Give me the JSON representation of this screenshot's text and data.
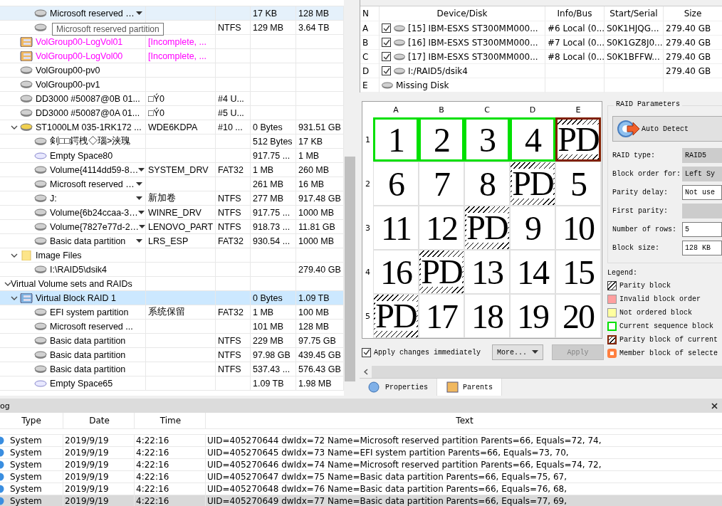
{
  "tree": {
    "tooltip": "Microsoft reserved partition",
    "items": [
      {
        "kind": "continued",
        "children": [
          {
            "kind": "continued",
            "children": [
              {
                "name": "Microsoft reserved …",
                "kind": "disk",
                "menu": true,
                "hovered": true,
                "cells": [
                  "",
                  "",
                  "17 KB",
                  "128 MB"
                ]
              },
              {
                "kind": "disk",
                "cells": [
                  "",
                  "NTFS",
                  "129 MB",
                  "3.64 TB"
                ]
              }
            ]
          },
          {
            "name": "VolGroup00-LogVol01",
            "kind": "volume-group",
            "incomplete": true,
            "cells": [
              "[Incomplete, ...",
              "",
              "",
              ""
            ]
          },
          {
            "name": "VolGroup00-LogVol00",
            "kind": "volume-group",
            "incomplete": true,
            "cells": [
              "[Incomplete, ...",
              "",
              "",
              ""
            ]
          },
          {
            "name": "VolGroup00-pv0",
            "kind": "disk",
            "cells": [
              "",
              "",
              "",
              ""
            ]
          },
          {
            "name": "VolGroup00-pv1",
            "kind": "disk",
            "cells": [
              "",
              "",
              "",
              ""
            ]
          },
          {
            "name": "DD3000 #50087@0B 01...",
            "kind": "disk",
            "cells": [
              "□Ý0",
              "#4 U...",
              "",
              ""
            ]
          },
          {
            "name": "DD3000 #50087@0A 01...",
            "kind": "disk",
            "cells": [
              "□Ý0",
              "#5 U...",
              "",
              ""
            ]
          },
          {
            "name": "ST1000LM 035-1RK172 ...",
            "kind": "yellow-disk",
            "expanded": true,
            "cells": [
              "WDE6KDPA",
              "#10 ...",
              "0 Bytes",
              "931.51 GB"
            ],
            "children": [
              {
                "name": "剣□□鍔栧◇瑙>浃瑰",
                "kind": "disk",
                "cells": [
                  "",
                  "",
                  "512 Bytes",
                  "17 KB"
                ]
              },
              {
                "name": "Empty Space80",
                "kind": "empty",
                "cells": [
                  "",
                  "",
                  "917.75 ...",
                  "1 MB"
                ]
              },
              {
                "name": "Volume{4114dd59-8…",
                "kind": "disk",
                "menu": true,
                "cells": [
                  "SYSTEM_DRV",
                  "FAT32",
                  "1 MB",
                  "260 MB"
                ]
              },
              {
                "name": "Microsoft reserved …",
                "kind": "disk",
                "menu": true,
                "cells": [
                  "",
                  "",
                  "261 MB",
                  "16 MB"
                ]
              },
              {
                "name": "J:",
                "kind": "disk",
                "menu": true,
                "cells": [
                  "新加卷",
                  "NTFS",
                  "277 MB",
                  "917.48 GB"
                ]
              },
              {
                "name": "Volume{6b24ccaa-3…",
                "kind": "disk",
                "menu": true,
                "cells": [
                  "WINRE_DRV",
                  "NTFS",
                  "917.75 ...",
                  "1000 MB"
                ]
              },
              {
                "name": "Volume{7827e77d-2…",
                "kind": "disk",
                "menu": true,
                "cells": [
                  "LENOVO_PART",
                  "NTFS",
                  "918.73 ...",
                  "11.81 GB"
                ]
              },
              {
                "name": "Basic data partition",
                "kind": "disk",
                "menu": true,
                "cells": [
                  "LRS_ESP",
                  "FAT32",
                  "930.54 ...",
                  "1000 MB"
                ]
              }
            ]
          },
          {
            "name": "Image Files",
            "kind": "folder",
            "expanded": true,
            "cells": [
              "",
              "",
              "",
              ""
            ],
            "children": [
              {
                "name": "I:\\RAID5\\dsik4",
                "kind": "disk",
                "cells": [
                  "",
                  "",
                  "",
                  "279.40 GB"
                ]
              }
            ]
          }
        ]
      },
      {
        "name": "Virtual Volume sets and RAIDs",
        "kind": "group",
        "expanded": true,
        "cells": [
          "",
          "",
          "",
          ""
        ],
        "children": [
          {
            "name": "Virtual Block RAID 1",
            "kind": "raid",
            "expanded": true,
            "selected": true,
            "cells": [
              "",
              "",
              "0 Bytes",
              "1.09 TB"
            ],
            "children": [
              {
                "name": "EFI system partition",
                "kind": "disk",
                "cells": [
                  "系统保留",
                  "FAT32",
                  "1 MB",
                  "100 MB"
                ]
              },
              {
                "name": "Microsoft reserved ...",
                "kind": "disk",
                "cells": [
                  "",
                  "",
                  "101 MB",
                  "128 MB"
                ]
              },
              {
                "name": "Basic data partition",
                "kind": "disk",
                "cells": [
                  "",
                  "NTFS",
                  "229 MB",
                  "97.75 GB"
                ]
              },
              {
                "name": "Basic data partition",
                "kind": "disk",
                "cells": [
                  "",
                  "NTFS",
                  "97.98 GB",
                  "439.45 GB"
                ]
              },
              {
                "name": "Basic data partition",
                "kind": "disk",
                "cells": [
                  "",
                  "NTFS",
                  "537.43 ...",
                  "576.43 GB"
                ]
              },
              {
                "name": "Empty Space65",
                "kind": "empty",
                "cells": [
                  "",
                  "",
                  "1.09 TB",
                  "1.98 MB"
                ]
              }
            ]
          }
        ]
      }
    ]
  },
  "disks": {
    "columns": [
      "N",
      "Device/Disk",
      "Info/Bus",
      "Start/Serial",
      "Size"
    ],
    "rows": [
      {
        "n": "A",
        "kind": "member",
        "checked": true,
        "device": "[15] IBM-ESXS ST300MM000...",
        "bus": "#6 Local (0...",
        "serial": "S0K1HJQG...",
        "size": "279.40 GB"
      },
      {
        "n": "B",
        "kind": "member",
        "checked": true,
        "device": "[16] IBM-ESXS ST300MM000...",
        "bus": "#7 Local (0...",
        "serial": "S0K1GZ8J0...",
        "size": "279.40 GB"
      },
      {
        "n": "C",
        "kind": "member",
        "checked": true,
        "device": "[17] IBM-ESXS ST300MM000...",
        "bus": "#8 Local (0...",
        "serial": "S0K1BFFW...",
        "size": "279.40 GB"
      },
      {
        "n": "D",
        "kind": "member",
        "checked": true,
        "device": "I:/RAID5/dsik4",
        "size": "279.40 GB"
      },
      {
        "n": "E",
        "kind": "missing",
        "device": "Missing Disk"
      }
    ]
  },
  "grid": {
    "columns": [
      "A",
      "B",
      "C",
      "D",
      "E"
    ],
    "rows": [
      {
        "label": "1",
        "cells": [
          {
            "text": "1",
            "kind": "data",
            "current": true
          },
          {
            "text": "2",
            "kind": "data",
            "current": true
          },
          {
            "text": "3",
            "kind": "data",
            "current": true
          },
          {
            "text": "4",
            "kind": "data",
            "current": true
          },
          {
            "text": "PD",
            "kind": "parity",
            "current": true
          }
        ]
      },
      {
        "label": "2",
        "cells": [
          {
            "text": "6",
            "kind": "data",
            "current": false
          },
          {
            "text": "7",
            "kind": "data",
            "current": false
          },
          {
            "text": "8",
            "kind": "data",
            "current": false
          },
          {
            "text": "PD",
            "kind": "parity",
            "current": false
          },
          {
            "text": "5",
            "kind": "data",
            "current": false
          }
        ]
      },
      {
        "label": "3",
        "cells": [
          {
            "text": "11",
            "kind": "data",
            "current": false
          },
          {
            "text": "12",
            "kind": "data",
            "current": false
          },
          {
            "text": "PD",
            "kind": "parity",
            "current": false
          },
          {
            "text": "9",
            "kind": "data",
            "current": false
          },
          {
            "text": "10",
            "kind": "data",
            "current": false
          }
        ]
      },
      {
        "label": "4",
        "cells": [
          {
            "text": "16",
            "kind": "data",
            "current": false
          },
          {
            "text": "PD",
            "kind": "parity",
            "current": false
          },
          {
            "text": "13",
            "kind": "data",
            "current": false
          },
          {
            "text": "14",
            "kind": "data",
            "current": false
          },
          {
            "text": "15",
            "kind": "data",
            "current": false
          }
        ]
      },
      {
        "label": "5",
        "cells": [
          {
            "text": "PD",
            "kind": "parity",
            "current": false
          },
          {
            "text": "17",
            "kind": "data",
            "current": false
          },
          {
            "text": "18",
            "kind": "data",
            "current": false
          },
          {
            "text": "19",
            "kind": "data",
            "current": false
          },
          {
            "text": "20",
            "kind": "data",
            "current": false
          }
        ]
      }
    ],
    "apply_immediately": {
      "label": "Apply changes immediately",
      "checked": true
    },
    "more": "More...",
    "apply": {
      "label": "Apply",
      "disabled": true
    }
  },
  "params": {
    "title": "RAID Parameters",
    "auto_detect": "Auto Detect",
    "fields": [
      {
        "label": "RAID type:",
        "value": "RAID5",
        "disabled": true
      },
      {
        "label": "Block order for:",
        "value": "Left Sy",
        "disabled": true
      },
      {
        "label": "Parity delay:",
        "value": "Not use",
        "disabled": false
      },
      {
        "label": "First parity:",
        "disabled": true
      },
      {
        "label": "Number of rows:",
        "value": "5",
        "disabled": false
      },
      {
        "label": "Block size:",
        "value": "128 KB",
        "disabled": false
      }
    ]
  },
  "legend": {
    "title": "Legend:",
    "items": [
      {
        "kind": "parity",
        "label": "Parity block"
      },
      {
        "kind": "fill",
        "color": "#ff9f9f",
        "label": "Invalid block order"
      },
      {
        "kind": "fill",
        "color": "#ffff9f",
        "label": "Not ordered block"
      },
      {
        "kind": "border",
        "color": "#00e000",
        "label": "Current sequence block"
      },
      {
        "kind": "border-parity",
        "color": "#802000",
        "label": "Parity block of current"
      },
      {
        "kind": "thick-border",
        "color": "#ff7f3f",
        "label": "Member block of selecte"
      }
    ]
  },
  "bottom_tabs": [
    {
      "label": "Properties",
      "selected": false
    },
    {
      "label": "Parents",
      "selected": true
    }
  ],
  "log": {
    "title": "og",
    "columns": [
      "Type",
      "Date",
      "Time",
      "Text"
    ],
    "rows": [
      {
        "type": "System",
        "date": "2019/9/19",
        "time": "4:22:16",
        "text": "UID=405270644 dwIdx=72 Name=Microsoft reserved partition  Parents=66,   Equals=72, 74,",
        "selected": false
      },
      {
        "type": "System",
        "date": "2019/9/19",
        "time": "4:22:16",
        "text": "UID=405270645 dwIdx=73 Name=EFI system partition  Parents=66,   Equals=73, 70,",
        "selected": false
      },
      {
        "type": "System",
        "date": "2019/9/19",
        "time": "4:22:16",
        "text": "UID=405270646 dwIdx=74 Name=Microsoft reserved partition  Parents=66,   Equals=74, 72,",
        "selected": false
      },
      {
        "type": "System",
        "date": "2019/9/19",
        "time": "4:22:16",
        "text": "UID=405270647 dwIdx=75 Name=Basic data partition  Parents=66,   Equals=75, 67,",
        "selected": false
      },
      {
        "type": "System",
        "date": "2019/9/19",
        "time": "4:22:16",
        "text": "UID=405270648 dwIdx=76 Name=Basic data partition  Parents=66,   Equals=76, 68,",
        "selected": false
      },
      {
        "type": "System",
        "date": "2019/9/19",
        "time": "4:22:16",
        "text": "UID=405270649 dwIdx=77 Name=Basic data partition  Parents=66,   Equals=77, 69,",
        "selected": true
      }
    ]
  }
}
